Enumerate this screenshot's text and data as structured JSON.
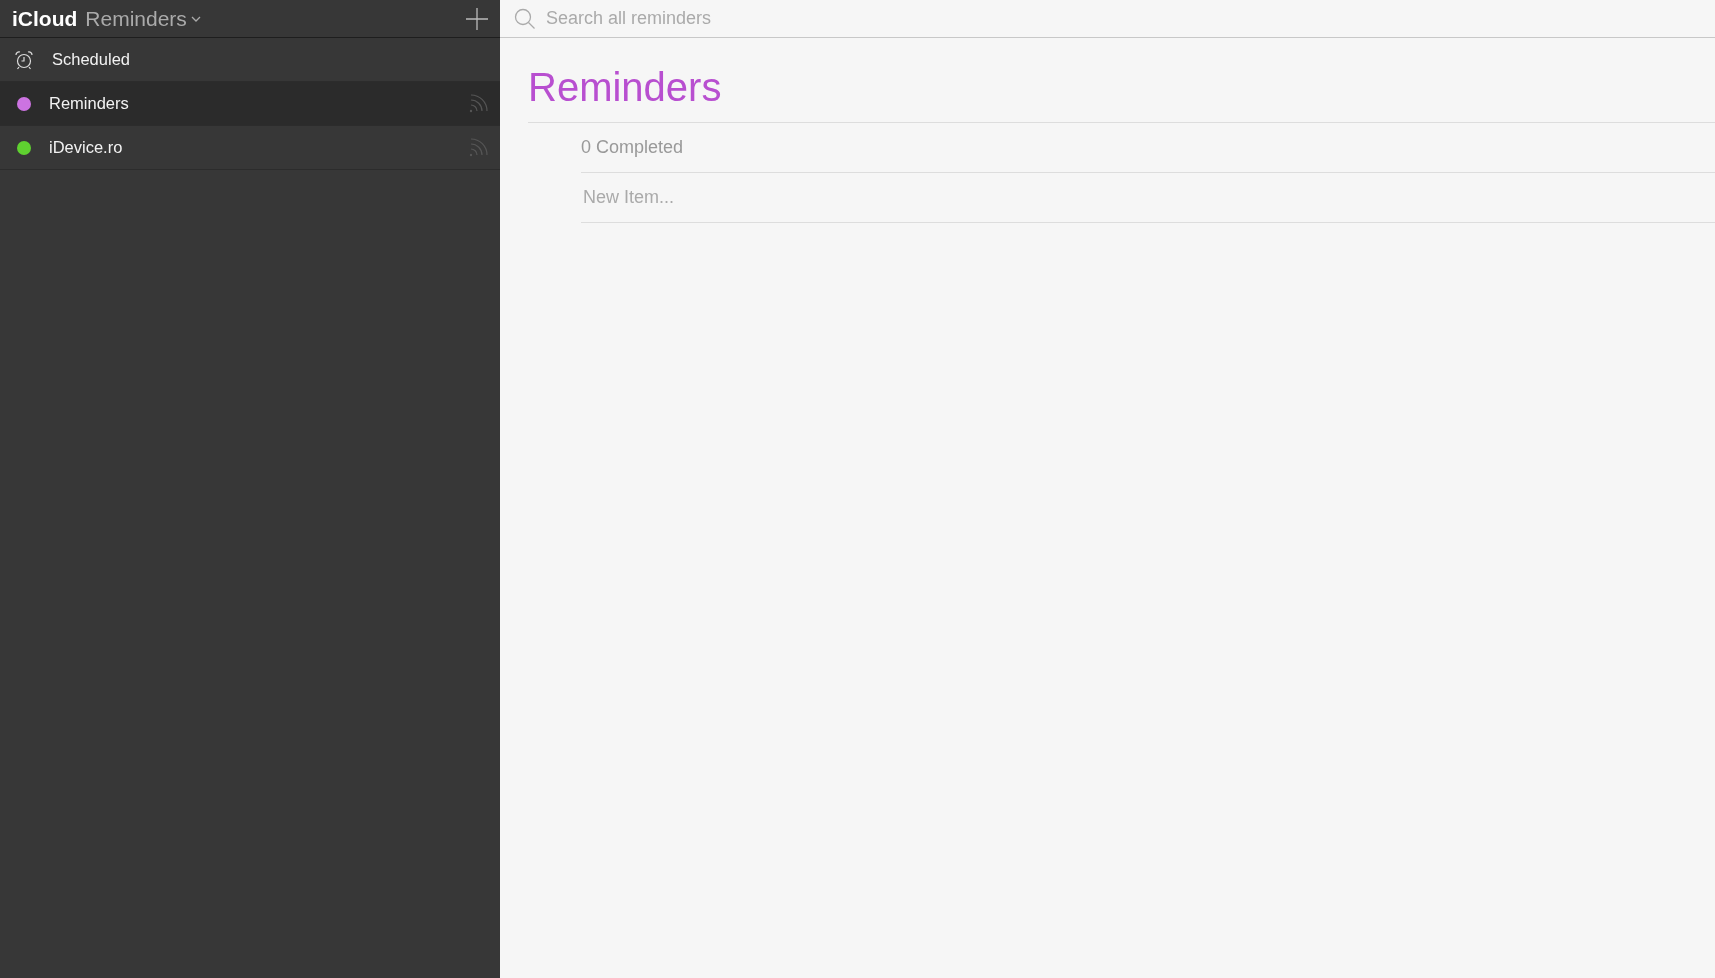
{
  "sidebar": {
    "brand": "iCloud",
    "app_title": "Reminders",
    "items": [
      {
        "kind": "scheduled",
        "label": "Scheduled",
        "selected": false
      },
      {
        "kind": "list",
        "label": "Reminders",
        "selected": true,
        "color": "#cc73e1"
      },
      {
        "kind": "list",
        "label": "iDevice.ro",
        "selected": false,
        "color": "#5fd130"
      }
    ]
  },
  "search": {
    "placeholder": "Search all reminders"
  },
  "list": {
    "title": "Reminders",
    "completed": "0 Completed",
    "new_item": {
      "placeholder": "New Item..."
    }
  }
}
